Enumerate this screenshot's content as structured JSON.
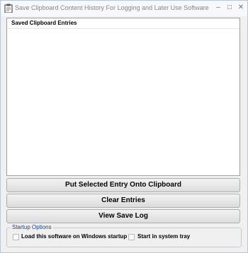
{
  "window": {
    "title": "Save Clipboard Content History For Logging and Later Use Software",
    "minimize": "–",
    "maximize": "□",
    "close": "✕"
  },
  "list": {
    "header": "Saved Clipboard Entries",
    "entries": []
  },
  "buttons": {
    "put_selected": "Put Selected Entry Onto Clipboard",
    "clear": "Clear Entries",
    "view_log": "View Save Log"
  },
  "startup": {
    "legend": "Startup Options",
    "load_on_startup": "Load this software on Windows startup",
    "load_on_startup_checked": false,
    "start_in_tray": "Start in system tray",
    "start_in_tray_checked": false
  }
}
